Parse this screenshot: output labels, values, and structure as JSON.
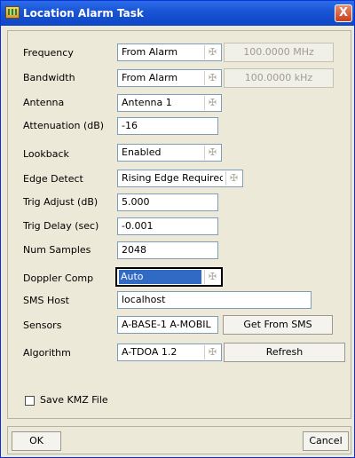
{
  "window": {
    "title": "Location Alarm Task",
    "close_glyph": "X"
  },
  "form": {
    "frequency": {
      "label": "Frequency",
      "value": "From Alarm",
      "value_button": "100.0000 MHz"
    },
    "bandwidth": {
      "label": "Bandwidth",
      "value": "From Alarm",
      "value_button": "100.0000 kHz"
    },
    "antenna": {
      "label": "Antenna",
      "value": "Antenna 1"
    },
    "attenuation": {
      "label": "Attenuation (dB)",
      "value": "-16"
    },
    "lookback": {
      "label": "Lookback",
      "value": "Enabled"
    },
    "edge_detect": {
      "label": "Edge Detect",
      "value": "Rising Edge Required"
    },
    "trig_adjust": {
      "label": "Trig Adjust (dB)",
      "value": "5.000"
    },
    "trig_delay": {
      "label": "Trig Delay (sec)",
      "value": "-0.001"
    },
    "num_samples": {
      "label": "Num Samples",
      "value": "2048"
    },
    "doppler_comp": {
      "label": "Doppler Comp",
      "value": "Auto"
    },
    "sms_host": {
      "label": "SMS Host",
      "value": "localhost"
    },
    "sensors": {
      "label": "Sensors",
      "value": "A-BASE-1 A-MOBIL",
      "button": "Get From SMS"
    },
    "algorithm": {
      "label": "Algorithm",
      "value": "A-TDOA 1.2",
      "button": "Refresh"
    },
    "save_kmz": {
      "label": "Save KMZ File",
      "checked": false
    }
  },
  "footer": {
    "ok_label": "OK",
    "cancel_label": "Cancel"
  },
  "icons": {
    "combo_arrow": "✠",
    "title_icon": "app-grid-icon"
  },
  "colors": {
    "titlebar": "#0d46c6",
    "selection": "#316ac5",
    "dialog_bg": "#ece9d8",
    "field_border": "#7f9db9"
  }
}
